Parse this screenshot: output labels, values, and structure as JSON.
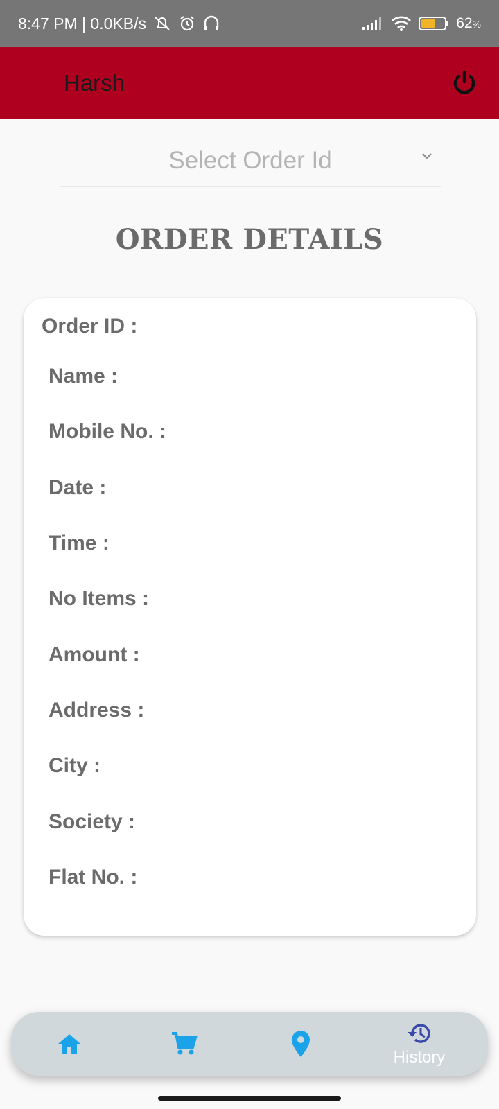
{
  "status_bar": {
    "time_net": "8:47 PM | 0.0KB/s",
    "battery_percent": "62",
    "battery_level": 0.62,
    "icons": [
      "mute-alarm-icon",
      "alarm-icon",
      "headphones-icon",
      "signal-icon",
      "wifi-icon",
      "battery-icon"
    ]
  },
  "appbar": {
    "title": "Harsh",
    "power_icon": "power-icon",
    "color": "#b00020"
  },
  "order_select": {
    "placeholder": "Select Order Id"
  },
  "section_title": "ORDER DETAILS",
  "details": {
    "order_id": "Order ID :",
    "name": "Name :",
    "mobile": "Mobile No. :",
    "date": "Date :",
    "time": "Time :",
    "items": "No Items :",
    "amount": "Amount :",
    "address": "Address :",
    "city": "City :",
    "society": "Society :",
    "flat": "Flat No. :"
  },
  "bottom_nav": {
    "items": [
      {
        "icon": "home-icon"
      },
      {
        "icon": "cart-icon"
      },
      {
        "icon": "location-icon"
      },
      {
        "icon": "history-icon",
        "label": "History"
      }
    ],
    "accent": "#1aa3e8",
    "active_color": "#3949ab"
  }
}
